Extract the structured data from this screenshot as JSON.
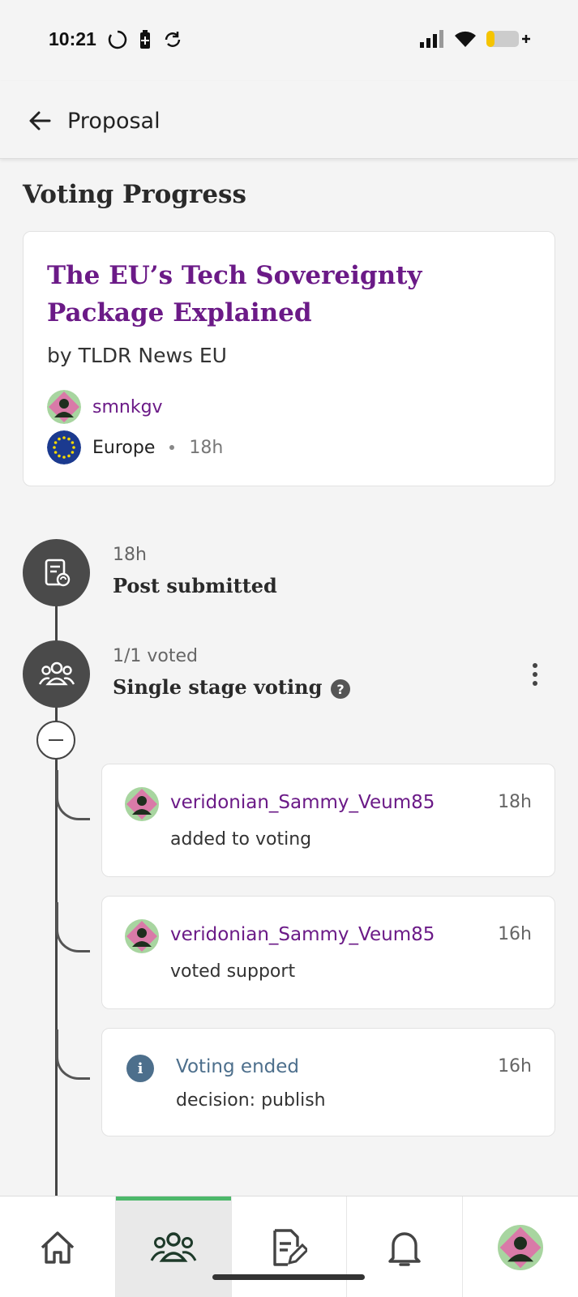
{
  "status_bar": {
    "time": "10:21"
  },
  "app_bar": {
    "title": "Proposal"
  },
  "section": {
    "title": "Voting Progress"
  },
  "post": {
    "title": "The EU’s Tech Sovereignty Package Explained",
    "byline": "by TLDR News EU",
    "author": "smnkgv",
    "community": "Europe",
    "age": "18h"
  },
  "timeline": {
    "submitted": {
      "time": "18h",
      "title": "Post submitted"
    },
    "voting": {
      "count": "1/1 voted",
      "title": "Single stage voting",
      "help": "?"
    },
    "events": [
      {
        "user": "veridonian_Sammy_Veum85",
        "time": "18h",
        "text": "added to voting"
      },
      {
        "user": "veridonian_Sammy_Veum85",
        "time": "16h",
        "text": "voted support"
      }
    ],
    "ended": {
      "title": "Voting ended",
      "time": "16h",
      "text": "decision: publish",
      "icon": "i"
    }
  },
  "colors": {
    "accent_purple": "#6b1a87",
    "info_blue": "#4d6f8c",
    "nav_active": "#4cb86a"
  }
}
